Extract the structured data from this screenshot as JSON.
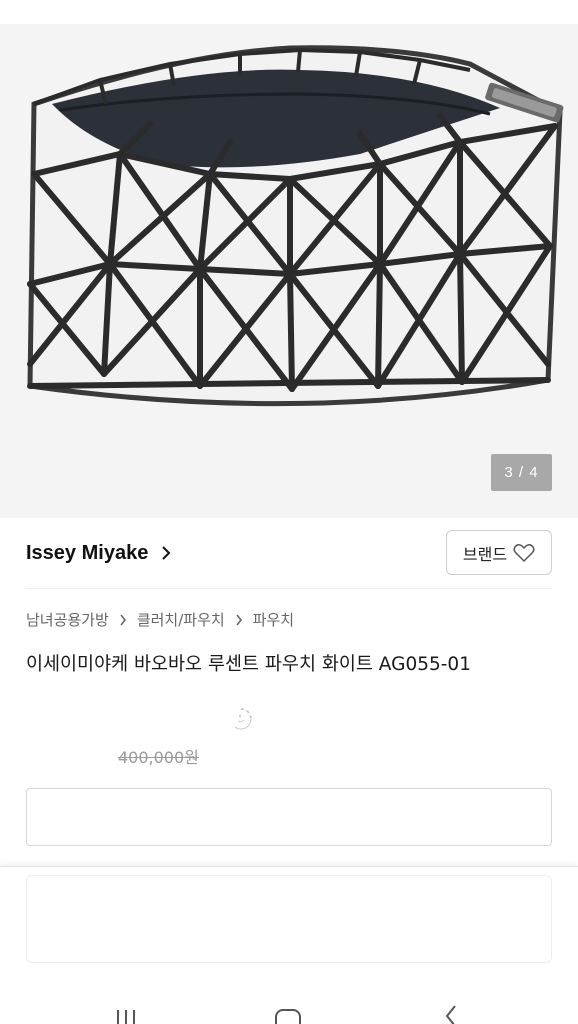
{
  "gallery": {
    "page_indicator": "3 / 4",
    "image_alt_icon": "bag-image"
  },
  "brand": {
    "name": "Issey Miyake",
    "button_label": "브랜드",
    "chevron_icon": "chevron-right-icon",
    "heart_icon": "heart-icon"
  },
  "breadcrumb": {
    "items": [
      "남녀공용가방",
      "클러치/파우치",
      "파우치"
    ]
  },
  "product": {
    "title": "이세이미야케 바오바오 루센트 파우치 화이트 AG055-01",
    "original_price": "400,000원"
  },
  "navigation": {
    "recent_icon": "recent-apps-icon",
    "home_icon": "home-icon",
    "back_icon": "back-icon"
  }
}
